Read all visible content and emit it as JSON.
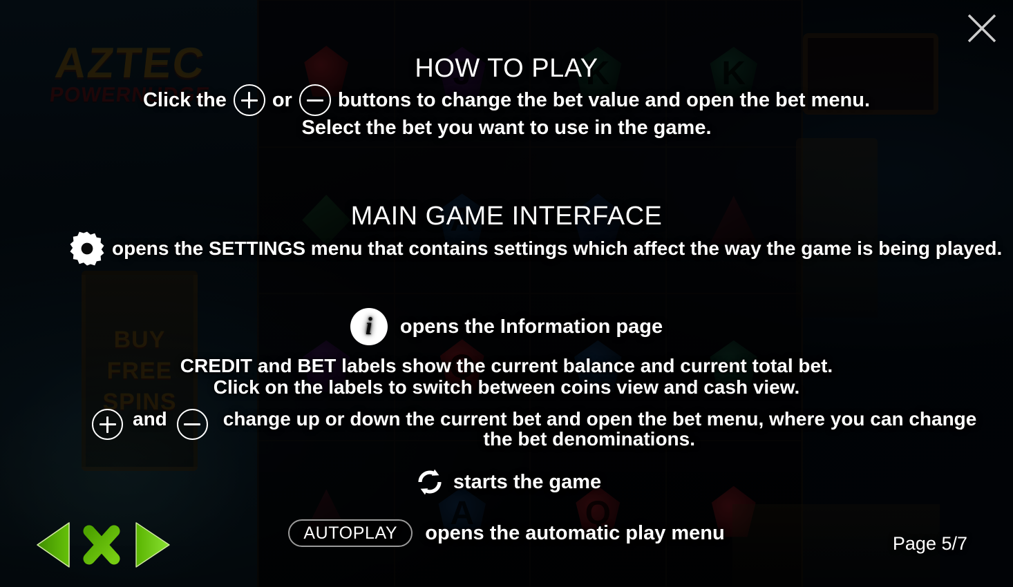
{
  "overlay": {
    "close_label": "close-overlay",
    "sections": [
      {
        "title": "HOW TO PLAY"
      },
      {
        "title": "MAIN GAME INTERFACE"
      }
    ],
    "how_to_play": {
      "title": "HOW TO PLAY",
      "click_prefix": "Click the",
      "or_word": "or",
      "click_suffix": "buttons to change the bet value and open the bet menu.",
      "select_line": "Select the bet you want to use in the game."
    },
    "main_game_interface": {
      "title": "MAIN GAME INTERFACE",
      "settings_text": "opens the SETTINGS menu that contains settings which affect the way the game is being played.",
      "info_text": "opens the Information page",
      "credit_line_1": "CREDIT and BET labels show the current balance and current total bet.",
      "credit_line_2": "Click on the labels to switch between coins view and cash view.",
      "bet_and_word": "and",
      "bet_text_line_1": "change up or down the current bet and open the bet menu, where you can change",
      "bet_text_line_2": "the bet denominations.",
      "spin_text": "starts the game",
      "autoplay_label": "AUTOPLAY",
      "autoplay_text": "opens the automatic play menu"
    },
    "footer": {
      "page_label": "Page 5/7"
    },
    "icons": {
      "close": "close-icon",
      "plus": "plus-circle-icon",
      "minus": "minus-circle-icon",
      "gear": "gear-icon",
      "info": "info-circle-icon",
      "info_glyph": "i",
      "spin": "refresh-spin-icon",
      "prev": "previous-arrow-icon",
      "exit": "exit-x-icon",
      "next": "next-arrow-icon"
    },
    "colors": {
      "text": "#ffffff",
      "nav_green_light": "#7ed321",
      "nav_green_dark": "#4fa300",
      "autoplay_border": "#9a9a9a",
      "close_x": "#cccccc",
      "backdrop": "#04080d"
    }
  },
  "background": {
    "logo_line_1": "AZTEC",
    "logo_line_2": "POWERNUDGE",
    "buy_free_spins": [
      "BUY",
      "FREE",
      "SPINS"
    ],
    "reel_symbols": [
      "gem-rd",
      "J",
      "K",
      "K",
      "diamond",
      "A",
      "pentagon",
      "triangle",
      "gem-pu",
      "Q",
      "gem-bl",
      "gem-gn",
      "triangle",
      "A",
      "Q",
      "gem-rd"
    ]
  }
}
